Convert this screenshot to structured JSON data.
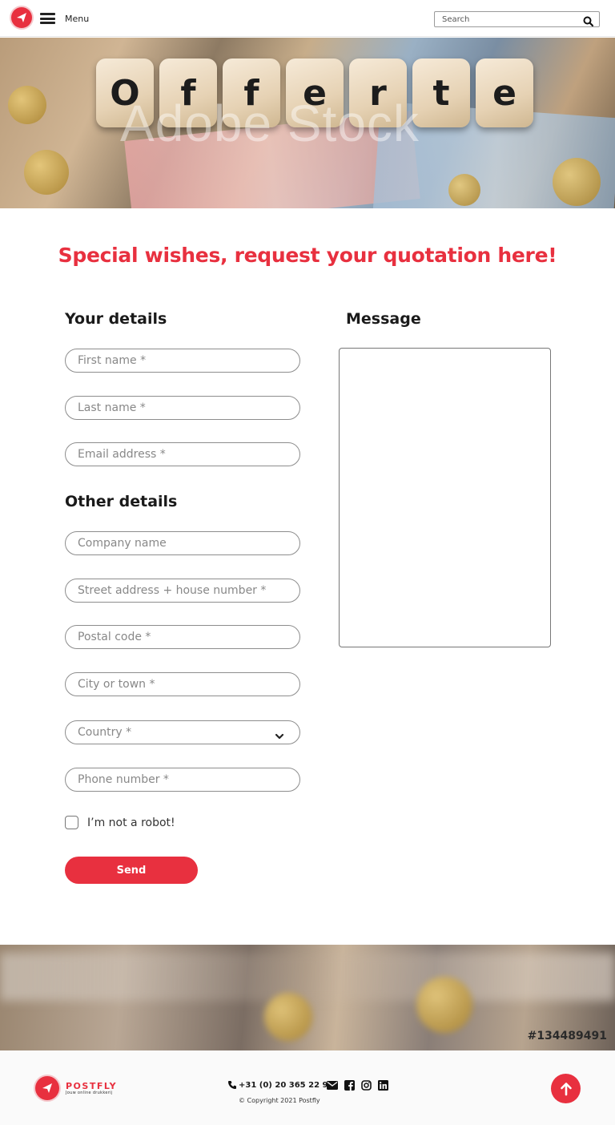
{
  "header": {
    "logo_name": "postfly-logo",
    "menu_label": "Menu",
    "search_placeholder": "Search"
  },
  "hero": {
    "letters": [
      "O",
      "f",
      "f",
      "e",
      "r",
      "t",
      "e"
    ],
    "watermark": "Adobe Stock"
  },
  "page": {
    "title": "Special wishes, request your quotation here!"
  },
  "sections": {
    "your_details": "Your details",
    "message": "Message",
    "other_details": "Other details"
  },
  "form": {
    "first_name": "First name *",
    "last_name": "Last name *",
    "email": "Email address *",
    "company": "Company name",
    "street": "Street address + house number *",
    "postal_code": "Postal code *",
    "city": "City or town *",
    "country": "Country *",
    "phone": "Phone number *",
    "robot_label": "I’m not a robot!",
    "send_label": "Send"
  },
  "banner": {
    "stock_id": "#134489491"
  },
  "footer": {
    "brand": "POSTFLY",
    "tagline": "Jouw online drukkerij",
    "phone": "+31 (0) 20 365 22 93",
    "copyright": "© Copyright 2021 Postfly"
  },
  "colors": {
    "accent": "#e8303f"
  }
}
